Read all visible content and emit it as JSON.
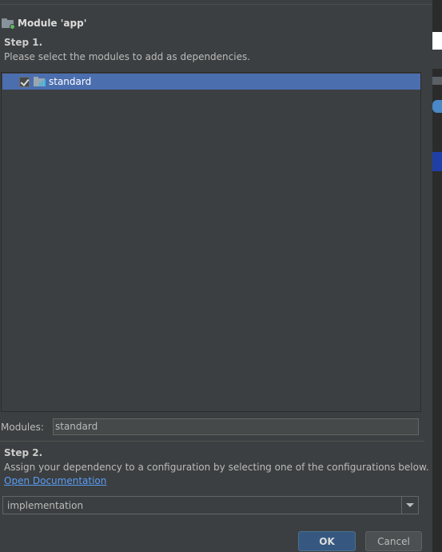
{
  "dialog": {
    "title": "Module 'app'"
  },
  "step1": {
    "title": "Step 1.",
    "description": "Please select the modules to add as dependencies."
  },
  "module_list": {
    "items": [
      {
        "label": "standard",
        "checked": true,
        "selected": true,
        "icon": "module-folder-icon"
      }
    ]
  },
  "modules_field": {
    "label": "Modules:",
    "value": "standard"
  },
  "step2": {
    "title": "Step 2.",
    "description": "Assign your dependency to a configuration by selecting one of the configurations below.",
    "link": "Open Documentation"
  },
  "configuration": {
    "selected": "implementation"
  },
  "buttons": {
    "ok": "OK",
    "cancel": "Cancel"
  },
  "colors": {
    "background": "#3c3f41",
    "selection": "#4b6eaf",
    "link": "#589df6",
    "ok_button": "#365880"
  }
}
